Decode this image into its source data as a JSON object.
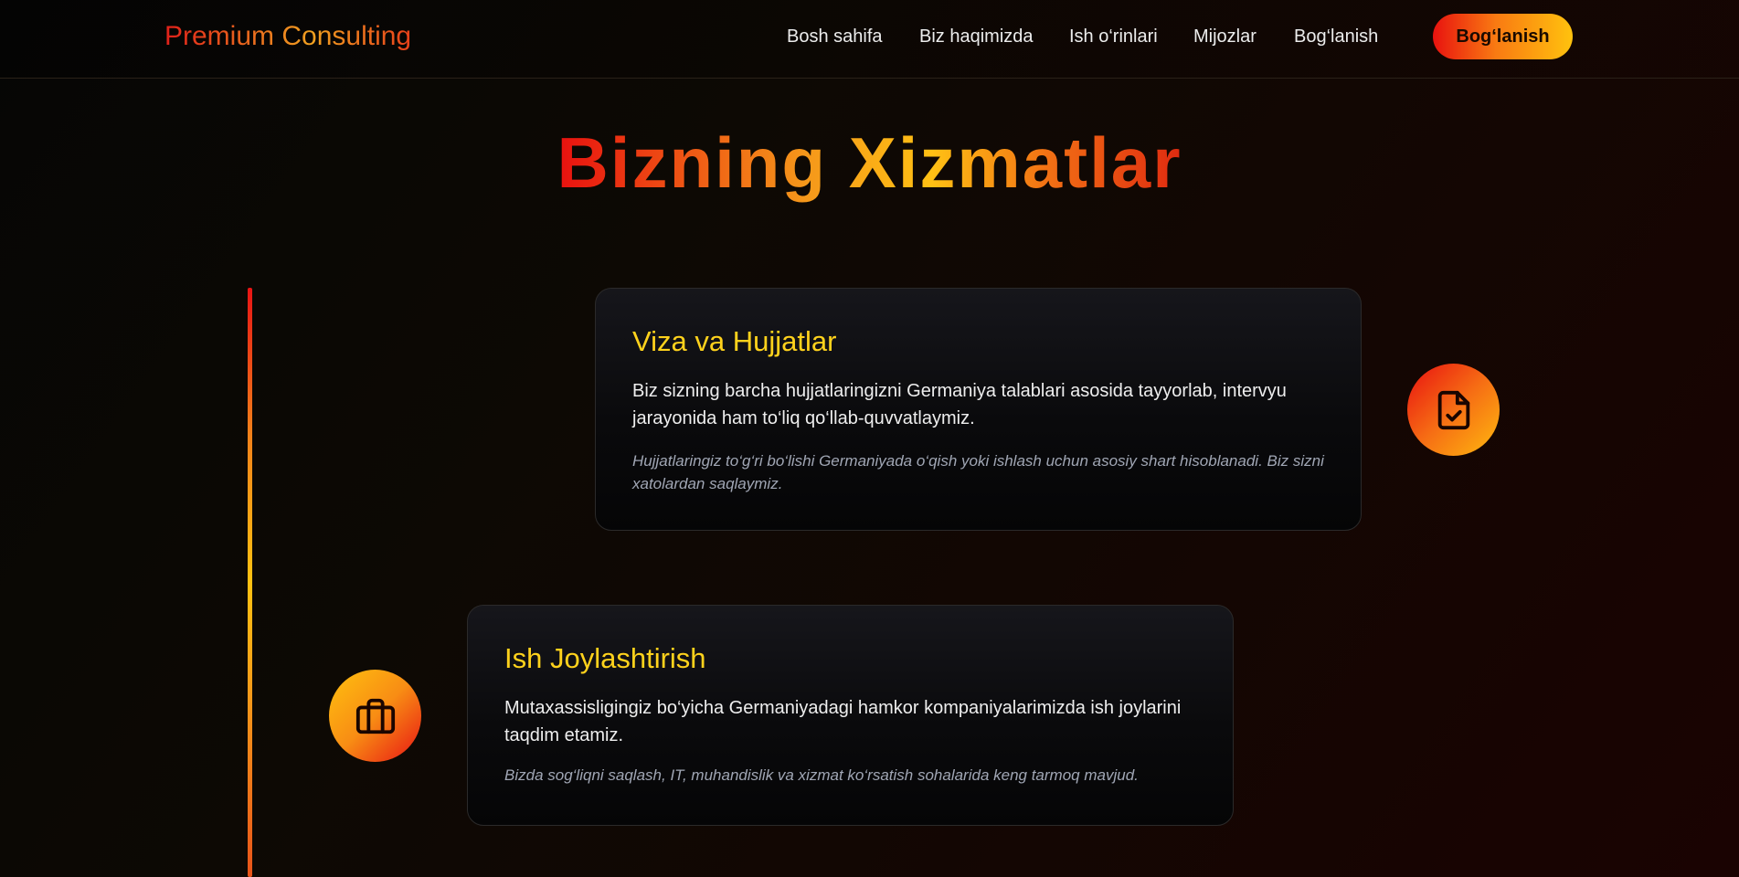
{
  "header": {
    "brand": "Premium Consulting",
    "nav": [
      {
        "label": "Bosh sahifa"
      },
      {
        "label": "Biz haqimizda"
      },
      {
        "label": "Ish o‘rinlari"
      },
      {
        "label": "Mijozlar"
      },
      {
        "label": "Bog‘lanish"
      }
    ],
    "cta_label": "Bog‘lanish"
  },
  "main": {
    "title": "Bizning Xizmatlar",
    "services": [
      {
        "title": "Viza va Hujjatlar",
        "text": "Biz sizning barcha hujjatlaringizni Germaniya talablari asosida tayyorlab, intervyu jarayonida ham to‘liq qo‘llab-quvvatlaymiz.",
        "note": "Hujjatlaringiz to‘g‘ri bo‘lishi Germaniyada o‘qish yoki ishlash uchun asosiy shart hisoblanadi. Biz sizni xatolardan saqlaymiz.",
        "icon": "file-check-icon"
      },
      {
        "title": "Ish Joylashtirish",
        "text": "Mutaxassisligingiz bo‘yicha Germaniyadagi hamkor kompaniyalarimizda ish joylarini taqdim etamiz.",
        "note": "Bizda sog‘liqni saqlash, IT, muhandislik va xizmat ko‘rsatish sohalarida keng tarmoq mavjud.",
        "icon": "briefcase-icon"
      }
    ]
  },
  "colors": {
    "accent_red": "#e8120f",
    "accent_orange": "#f97a12",
    "accent_yellow": "#ffc20e",
    "card_title": "#ffd21c"
  }
}
